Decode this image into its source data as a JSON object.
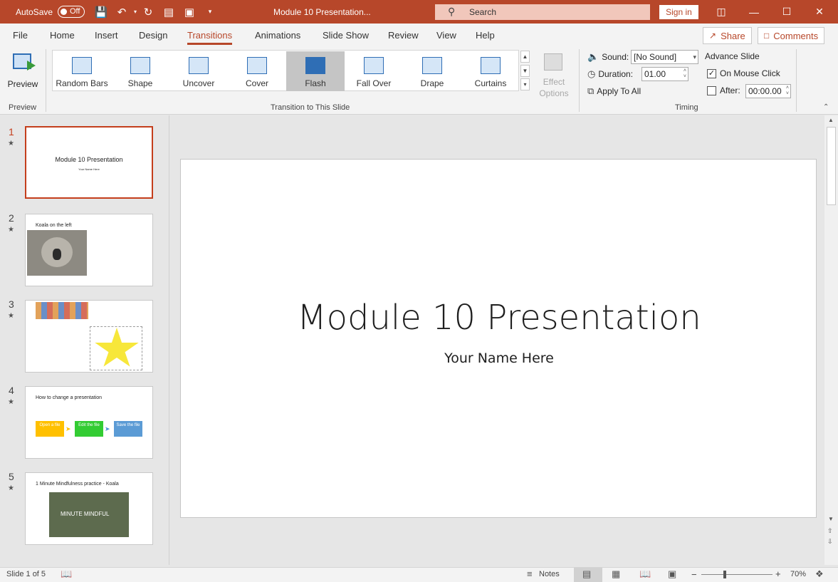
{
  "window": {
    "autosave_label": "AutoSave",
    "autosave_state": "Off",
    "title": "Module 10 Presentation...",
    "search_placeholder": "Search",
    "signin": "Sign in",
    "accent_color": "#b7472a"
  },
  "menu": {
    "tabs": [
      "File",
      "Home",
      "Insert",
      "Design",
      "Transitions",
      "Animations",
      "Slide Show",
      "Review",
      "View",
      "Help"
    ],
    "active_tab": "Transitions",
    "share": "Share",
    "comments": "Comments"
  },
  "ribbon": {
    "preview_label": "Preview",
    "preview_group": "Preview",
    "transitions": [
      "Random Bars",
      "Shape",
      "Uncover",
      "Cover",
      "Flash",
      "Fall Over",
      "Drape",
      "Curtains"
    ],
    "selected_transition": "Flash",
    "effect_options": "Effect Options",
    "transition_group": "Transition to This Slide",
    "sound_label": "Sound:",
    "sound_value": "[No Sound]",
    "duration_label": "Duration:",
    "duration_value": "01.00",
    "apply_all": "Apply To All",
    "advance_label": "Advance Slide",
    "on_mouse_click": "On Mouse Click",
    "on_mouse_click_checked": true,
    "after_label": "After:",
    "after_value": "00:00.00",
    "after_checked": false,
    "timing_group": "Timing"
  },
  "thumbnails": [
    {
      "number": "1",
      "title": "Module 10 Presentation",
      "subtitle": "Your Name Here"
    },
    {
      "number": "2",
      "title": "Koala on the left"
    },
    {
      "number": "3",
      "title": ""
    },
    {
      "number": "4",
      "title": "How to change a presentation",
      "steps": [
        "Open a file",
        "Edit the file",
        "Save the file"
      ]
    },
    {
      "number": "5",
      "title": "1 Minute Mindfulness practice - Koala",
      "image_text": "MINUTE MINDFUL"
    }
  ],
  "slide": {
    "title": "Module 10 Presentation",
    "subtitle": "Your Name Here"
  },
  "status": {
    "slide_info": "Slide 1 of 5",
    "notes": "Notes",
    "zoom": "70%"
  }
}
